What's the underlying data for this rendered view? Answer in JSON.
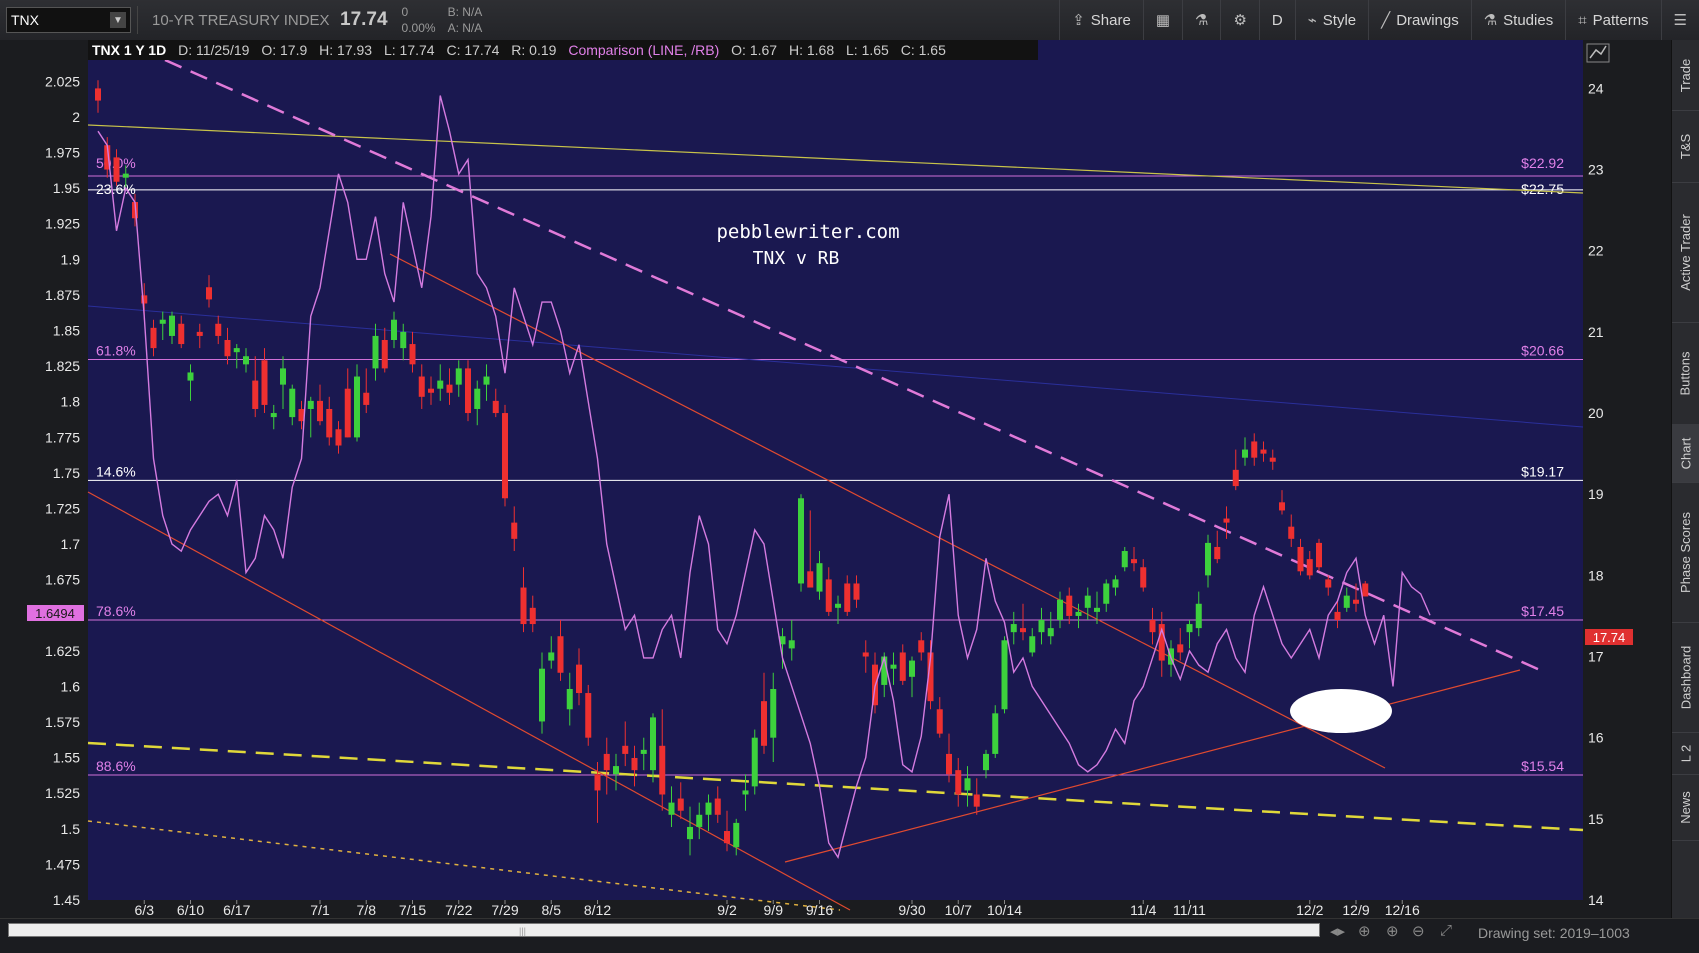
{
  "toolbar": {
    "symbol": "TNX",
    "description": "10-YR TREASURY INDEX",
    "last": "17.74",
    "change": "0",
    "change_pct": "0.00%",
    "bid": "B: N/A",
    "ask": "A: N/A",
    "share_label": "Share",
    "aggregation_label": "D",
    "style_label": "Style",
    "drawings_label": "Drawings",
    "studies_label": "Studies",
    "patterns_label": "Patterns"
  },
  "side_tabs": [
    "Trade",
    "T&S",
    "Active Trader",
    "Buttons",
    "Chart",
    "Phase Scores",
    "Dashboard",
    "L 2",
    "News"
  ],
  "bottom": {
    "drawing_set": "Drawing set: 2019–1003",
    "scroll_grip": "|||"
  },
  "chart_data": {
    "type": "candlestick",
    "header": {
      "title": "TNX 1 Y 1D",
      "d": "D: 11/25/19",
      "o": "O: 17.9",
      "h": "H: 17.93",
      "l": "L: 17.74",
      "c": "C: 17.74",
      "r": "R: 0.19",
      "comparison": "Comparison (LINE, /RB)",
      "co": "O: 1.67",
      "ch": "H: 1.68",
      "cl": "L: 1.65",
      "cc": "C: 1.65"
    },
    "annotation_lines": [
      "pebblewriter.com",
      "TNX v RB"
    ],
    "x_labels": [
      {
        "t": "6/3",
        "i": 5
      },
      {
        "t": "6/10",
        "i": 10
      },
      {
        "t": "6/17",
        "i": 15
      },
      {
        "t": "7/1",
        "i": 24
      },
      {
        "t": "7/8",
        "i": 29
      },
      {
        "t": "7/15",
        "i": 34
      },
      {
        "t": "7/22",
        "i": 39
      },
      {
        "t": "7/29",
        "i": 44
      },
      {
        "t": "8/5",
        "i": 49
      },
      {
        "t": "8/12",
        "i": 54
      },
      {
        "t": "9/2",
        "i": 68
      },
      {
        "t": "9/9",
        "i": 73
      },
      {
        "t": "9/16",
        "i": 78
      },
      {
        "t": "9/30",
        "i": 88
      },
      {
        "t": "10/7",
        "i": 93
      },
      {
        "t": "10/14",
        "i": 98
      },
      {
        "t": "11/4",
        "i": 113
      },
      {
        "t": "11/11",
        "i": 118
      },
      {
        "t": "12/2",
        "i": 131
      },
      {
        "t": "12/9",
        "i": 136
      },
      {
        "t": "12/16",
        "i": 141
      }
    ],
    "left_axis": {
      "min": 1.45,
      "max": 2.04,
      "ticks": [
        "2.025",
        "2",
        "1.975",
        "1.95",
        "1.925",
        "1.9",
        "1.875",
        "1.85",
        "1.825",
        "1.8",
        "1.775",
        "1.75",
        "1.725",
        "1.7",
        "1.675",
        "1.65",
        "1.625",
        "1.6",
        "1.575",
        "1.55",
        "1.525",
        "1.5",
        "1.475",
        "1.45"
      ],
      "marker": "1.6494"
    },
    "right_axis": {
      "min": 14,
      "max": 24.35,
      "ticks": [
        "24",
        "23",
        "22",
        "21",
        "20",
        "19",
        "18",
        "17",
        "16",
        "15",
        "14"
      ],
      "marker": "17.74"
    },
    "fib_levels": [
      {
        "pct": "50.0%",
        "value": "$22.92",
        "price": 22.92
      },
      {
        "pct": "23.6%",
        "value": "$22.75",
        "price": 22.75
      },
      {
        "pct": "61.8%",
        "value": "$20.66",
        "price": 20.66
      },
      {
        "pct": "14.6%",
        "value": "$19.17",
        "price": 19.17
      },
      {
        "pct": "78.6%",
        "value": "$17.45",
        "price": 17.45
      },
      {
        "pct": "88.6%",
        "value": "$15.54",
        "price": 15.54
      }
    ],
    "candles": [
      [
        24.0,
        24.1,
        23.7,
        23.85
      ],
      [
        23.3,
        23.4,
        22.9,
        23.0
      ],
      [
        23.15,
        23.25,
        22.8,
        22.85
      ],
      [
        22.9,
        23.05,
        22.75,
        22.95
      ],
      [
        22.6,
        22.7,
        22.3,
        22.4
      ],
      [
        21.45,
        21.6,
        21.15,
        21.35
      ],
      [
        21.05,
        21.15,
        20.7,
        20.8
      ],
      [
        21.1,
        21.25,
        20.9,
        21.15
      ],
      [
        20.95,
        21.25,
        20.85,
        21.2
      ],
      [
        21.1,
        21.2,
        20.8,
        20.85
      ],
      [
        20.4,
        20.6,
        20.15,
        20.5
      ],
      [
        21.0,
        21.1,
        20.8,
        20.95
      ],
      [
        21.55,
        21.7,
        21.3,
        21.4
      ],
      [
        21.1,
        21.2,
        20.85,
        20.95
      ],
      [
        20.9,
        21.05,
        20.6,
        20.7
      ],
      [
        20.75,
        20.85,
        20.55,
        20.8
      ],
      [
        20.6,
        20.8,
        20.5,
        20.7
      ],
      [
        20.4,
        20.7,
        19.95,
        20.05
      ],
      [
        20.65,
        20.8,
        20.0,
        20.1
      ],
      [
        19.95,
        20.1,
        19.8,
        20.0
      ],
      [
        20.35,
        20.7,
        20.05,
        20.55
      ],
      [
        19.95,
        20.35,
        19.85,
        20.3
      ],
      [
        20.05,
        20.15,
        19.8,
        19.9
      ],
      [
        20.05,
        20.2,
        19.7,
        20.15
      ],
      [
        20.15,
        20.35,
        19.85,
        19.9
      ],
      [
        20.05,
        20.2,
        19.6,
        19.7
      ],
      [
        19.8,
        19.9,
        19.5,
        19.6
      ],
      [
        20.3,
        20.55,
        19.7,
        19.7
      ],
      [
        19.7,
        20.6,
        19.65,
        20.45
      ],
      [
        20.25,
        20.55,
        20.0,
        20.1
      ],
      [
        20.55,
        21.1,
        20.4,
        20.95
      ],
      [
        20.9,
        21.05,
        20.5,
        20.55
      ],
      [
        20.9,
        21.25,
        20.8,
        21.15
      ],
      [
        20.8,
        21.1,
        20.65,
        21.0
      ],
      [
        20.85,
        21.0,
        20.5,
        20.6
      ],
      [
        20.45,
        20.6,
        20.05,
        20.2
      ],
      [
        20.3,
        20.45,
        20.1,
        20.25
      ],
      [
        20.3,
        20.6,
        20.15,
        20.4
      ],
      [
        20.35,
        20.55,
        20.1,
        20.25
      ],
      [
        20.35,
        20.65,
        20.2,
        20.55
      ],
      [
        20.55,
        20.65,
        19.9,
        20.0
      ],
      [
        20.05,
        20.4,
        19.85,
        20.3
      ],
      [
        20.35,
        20.6,
        20.15,
        20.45
      ],
      [
        20.15,
        20.3,
        19.95,
        20.0
      ],
      [
        20.0,
        20.1,
        18.85,
        18.95
      ],
      [
        18.65,
        18.85,
        18.3,
        18.45
      ],
      [
        17.85,
        18.1,
        17.3,
        17.4
      ],
      [
        17.6,
        17.75,
        17.3,
        17.4
      ],
      [
        16.2,
        17.05,
        16.05,
        16.85
      ],
      [
        16.95,
        17.25,
        16.85,
        17.05
      ],
      [
        17.25,
        17.45,
        16.7,
        16.8
      ],
      [
        16.35,
        16.8,
        16.15,
        16.6
      ],
      [
        16.9,
        17.1,
        16.4,
        16.55
      ],
      [
        16.55,
        16.65,
        15.9,
        16.0
      ],
      [
        15.55,
        15.7,
        14.95,
        15.35
      ],
      [
        15.8,
        16.0,
        15.3,
        15.6
      ],
      [
        15.55,
        15.8,
        15.35,
        15.65
      ],
      [
        15.9,
        16.2,
        15.65,
        15.8
      ],
      [
        15.75,
        15.9,
        15.4,
        15.6
      ],
      [
        15.8,
        16.0,
        15.6,
        15.85
      ],
      [
        15.6,
        16.3,
        15.45,
        16.25
      ],
      [
        15.9,
        16.35,
        15.1,
        15.3
      ],
      [
        15.05,
        15.4,
        14.9,
        15.2
      ],
      [
        15.25,
        15.45,
        15.0,
        15.1
      ],
      [
        14.75,
        15.15,
        14.55,
        14.9
      ],
      [
        14.9,
        15.2,
        14.75,
        15.05
      ],
      [
        15.05,
        15.3,
        14.85,
        15.2
      ],
      [
        15.25,
        15.4,
        14.95,
        15.05
      ],
      [
        14.85,
        15.1,
        14.6,
        14.7
      ],
      [
        14.65,
        15.0,
        14.55,
        14.95
      ],
      [
        15.3,
        15.55,
        15.1,
        15.35
      ],
      [
        15.4,
        16.1,
        15.3,
        16.0
      ],
      [
        16.45,
        16.8,
        15.8,
        15.9
      ],
      [
        16.0,
        16.8,
        15.7,
        16.6
      ],
      [
        17.15,
        17.35,
        16.85,
        17.25
      ],
      [
        17.1,
        17.45,
        16.95,
        17.2
      ],
      [
        17.9,
        19.0,
        17.8,
        18.95
      ],
      [
        18.05,
        18.8,
        17.9,
        17.85
      ],
      [
        17.8,
        18.3,
        17.7,
        18.15
      ],
      [
        17.95,
        18.1,
        17.5,
        17.55
      ],
      [
        17.6,
        17.75,
        17.4,
        17.65
      ],
      [
        17.9,
        18.0,
        17.5,
        17.55
      ],
      [
        17.9,
        18.0,
        17.6,
        17.7
      ],
      [
        17.05,
        17.2,
        16.8,
        17.0
      ],
      [
        16.9,
        17.05,
        16.3,
        16.4
      ],
      [
        16.65,
        17.05,
        16.5,
        17.0
      ],
      [
        16.85,
        17.05,
        16.65,
        16.9
      ],
      [
        17.05,
        17.15,
        16.65,
        16.7
      ],
      [
        16.75,
        17.0,
        16.5,
        16.95
      ],
      [
        17.2,
        17.3,
        16.95,
        17.05
      ],
      [
        17.05,
        17.2,
        16.35,
        16.45
      ],
      [
        16.35,
        16.5,
        16.0,
        16.05
      ],
      [
        15.8,
        16.05,
        15.45,
        15.55
      ],
      [
        15.6,
        15.75,
        15.15,
        15.3
      ],
      [
        15.35,
        15.65,
        15.15,
        15.5
      ],
      [
        15.3,
        15.5,
        15.05,
        15.15
      ],
      [
        15.6,
        15.85,
        15.5,
        15.8
      ],
      [
        15.8,
        16.4,
        15.75,
        16.3
      ],
      [
        16.35,
        17.25,
        16.3,
        17.2
      ],
      [
        17.3,
        17.55,
        17.15,
        17.4
      ],
      [
        17.35,
        17.65,
        17.2,
        17.3
      ],
      [
        17.05,
        17.35,
        17.0,
        17.25
      ],
      [
        17.3,
        17.6,
        17.15,
        17.45
      ],
      [
        17.25,
        17.55,
        17.15,
        17.35
      ],
      [
        17.45,
        17.8,
        17.35,
        17.7
      ],
      [
        17.75,
        17.85,
        17.4,
        17.5
      ],
      [
        17.5,
        17.65,
        17.35,
        17.55
      ],
      [
        17.6,
        17.85,
        17.45,
        17.75
      ],
      [
        17.55,
        17.8,
        17.4,
        17.6
      ],
      [
        17.65,
        17.95,
        17.55,
        17.9
      ],
      [
        17.85,
        18.0,
        17.75,
        17.95
      ],
      [
        18.1,
        18.35,
        18.05,
        18.3
      ],
      [
        18.2,
        18.35,
        18.05,
        18.15
      ],
      [
        18.1,
        18.2,
        17.8,
        17.85
      ],
      [
        17.45,
        17.6,
        17.15,
        17.3
      ],
      [
        17.4,
        17.55,
        16.75,
        16.95
      ],
      [
        16.9,
        17.2,
        16.75,
        17.1
      ],
      [
        17.15,
        17.35,
        16.95,
        17.05
      ],
      [
        17.3,
        17.45,
        17.1,
        17.4
      ],
      [
        17.35,
        17.8,
        17.25,
        17.65
      ],
      [
        18.0,
        18.5,
        17.85,
        18.4
      ],
      [
        18.35,
        18.55,
        18.15,
        18.2
      ],
      [
        18.7,
        18.85,
        18.45,
        18.65
      ],
      [
        19.3,
        19.55,
        19.05,
        19.1
      ],
      [
        19.45,
        19.7,
        19.35,
        19.55
      ],
      [
        19.65,
        19.75,
        19.35,
        19.45
      ],
      [
        19.55,
        19.65,
        19.4,
        19.5
      ],
      [
        19.45,
        19.55,
        19.3,
        19.4
      ],
      [
        18.9,
        19.05,
        18.75,
        18.8
      ],
      [
        18.6,
        18.75,
        18.35,
        18.45
      ],
      [
        18.35,
        18.45,
        18.0,
        18.05
      ],
      [
        18.2,
        18.3,
        17.95,
        18.0
      ],
      [
        18.4,
        18.45,
        18.05,
        18.1
      ],
      [
        17.95,
        18.0,
        17.75,
        17.85
      ],
      [
        17.55,
        17.7,
        17.35,
        17.45
      ],
      [
        17.6,
        17.85,
        17.55,
        17.75
      ],
      [
        17.7,
        17.9,
        17.55,
        17.65
      ],
      [
        17.9,
        17.93,
        17.74,
        17.74
      ]
    ],
    "comparison_line": [
      1.99,
      1.98,
      1.92,
      1.95,
      1.94,
      1.86,
      1.76,
      1.72,
      1.7,
      1.695,
      1.71,
      1.72,
      1.73,
      1.735,
      1.72,
      1.745,
      1.68,
      1.69,
      1.72,
      1.71,
      1.69,
      1.74,
      1.76,
      1.86,
      1.88,
      1.92,
      1.96,
      1.94,
      1.9,
      1.9,
      1.93,
      1.89,
      1.87,
      1.94,
      1.91,
      1.88,
      1.93,
      2.015,
      1.99,
      1.96,
      1.97,
      1.89,
      1.88,
      1.86,
      1.82,
      1.88,
      1.86,
      1.84,
      1.87,
      1.87,
      1.85,
      1.82,
      1.84,
      1.8,
      1.76,
      1.7,
      1.67,
      1.64,
      1.65,
      1.62,
      1.62,
      1.64,
      1.65,
      1.62,
      1.68,
      1.72,
      1.7,
      1.64,
      1.63,
      1.65,
      1.68,
      1.71,
      1.7,
      1.66,
      1.62,
      1.6,
      1.58,
      1.56,
      1.53,
      1.49,
      1.48,
      1.505,
      1.53,
      1.55,
      1.6,
      1.62,
      1.59,
      1.545,
      1.54,
      1.565,
      1.62,
      1.705,
      1.735,
      1.65,
      1.62,
      1.64,
      1.69,
      1.66,
      1.645,
      1.61,
      1.62,
      1.6,
      1.59,
      1.58,
      1.57,
      1.56,
      1.545,
      1.54,
      1.545,
      1.555,
      1.57,
      1.56,
      1.59,
      1.6,
      1.62,
      1.64,
      1.62,
      1.605,
      1.625,
      1.615,
      1.61,
      1.63,
      1.64,
      1.62,
      1.61,
      1.65,
      1.67,
      1.65,
      1.63,
      1.62,
      1.63,
      1.64,
      1.62,
      1.65,
      1.66,
      1.68,
      1.69,
      1.65,
      1.63,
      1.65,
      1.6,
      1.68,
      1.67,
      1.665,
      1.65
    ]
  }
}
